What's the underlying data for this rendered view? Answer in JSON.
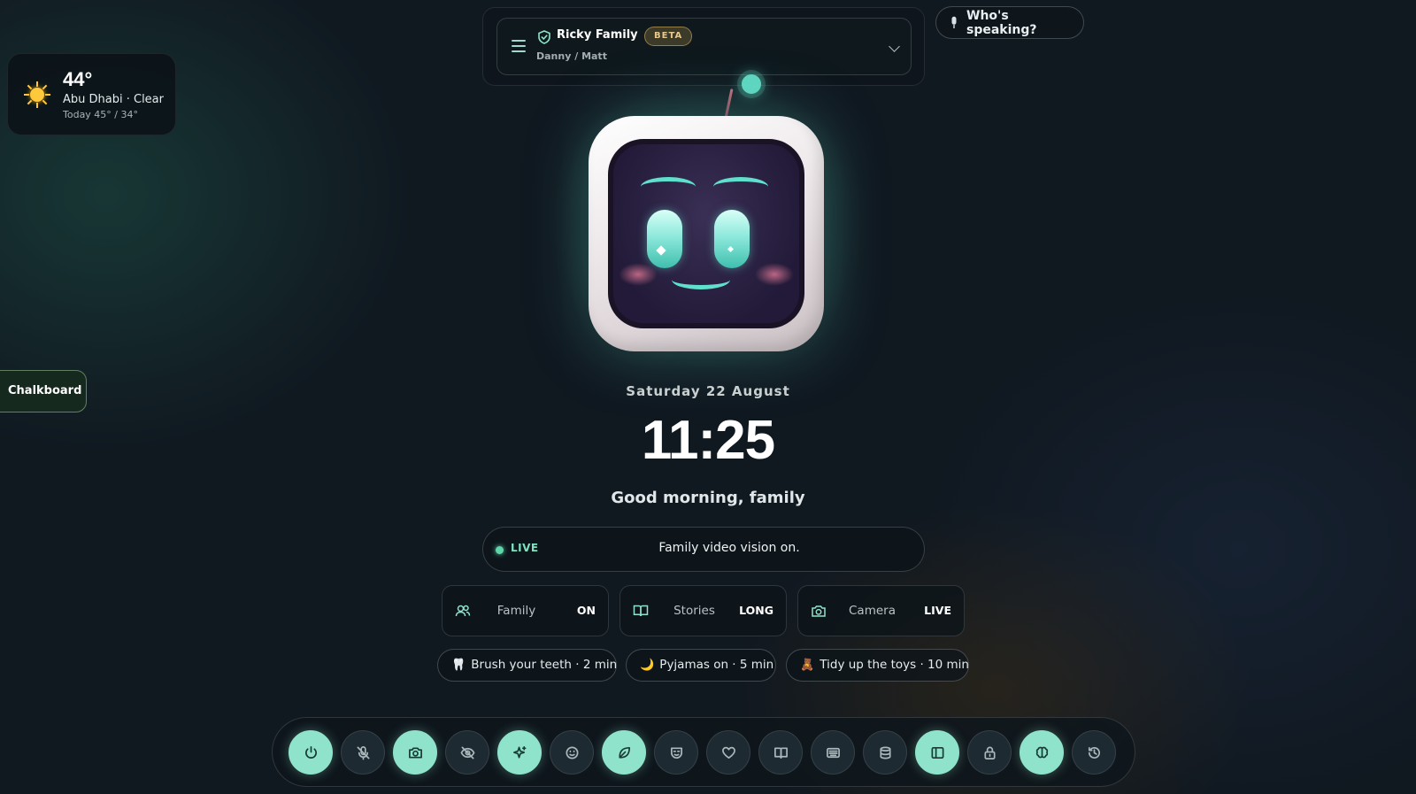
{
  "weather": {
    "temperature": "44°",
    "location": "Abu Dhabi · Clear",
    "forecast": "Today 45° / 34°",
    "icon": "sun-icon"
  },
  "header": {
    "title": "Ricky Family",
    "badge": "BETA",
    "subtitle": "Danny / Matt"
  },
  "speaking_button": {
    "label": "Who's speaking?",
    "icon": "microphone-icon"
  },
  "clock": {
    "date": "Saturday 22 August",
    "time": "11:25",
    "greeting": "Good morning, family"
  },
  "live_status": {
    "tag": "LIVE",
    "message": "Family video vision on."
  },
  "status_tiles": [
    {
      "name": "Family",
      "value": "ON",
      "icon": "family-icon"
    },
    {
      "name": "Stories",
      "value": "LONG",
      "icon": "book-icon"
    },
    {
      "name": "Camera",
      "value": "LIVE",
      "icon": "camera-icon"
    }
  ],
  "routines": [
    {
      "emoji": "🦷",
      "label": "Brush your teeth · 2 min"
    },
    {
      "emoji": "🌙",
      "label": "Pyjamas on · 5 min"
    },
    {
      "emoji": "🧸",
      "label": "Tidy up the toys · 10 min"
    }
  ],
  "chalkboard": {
    "label": "Chalkboard"
  },
  "dock": [
    {
      "name": "power-icon",
      "active": true
    },
    {
      "name": "mic-off-icon",
      "active": false
    },
    {
      "name": "camera-icon",
      "active": true
    },
    {
      "name": "eye-off-icon",
      "active": false
    },
    {
      "name": "sparkle-icon",
      "active": true
    },
    {
      "name": "face-icon",
      "active": false
    },
    {
      "name": "leaf-icon",
      "active": true
    },
    {
      "name": "mask-icon",
      "active": false
    },
    {
      "name": "heart-icon",
      "active": false
    },
    {
      "name": "book-icon",
      "active": false
    },
    {
      "name": "keyboard-icon",
      "active": false
    },
    {
      "name": "database-icon",
      "active": false
    },
    {
      "name": "panel-icon",
      "active": true
    },
    {
      "name": "lock-icon",
      "active": false
    },
    {
      "name": "brain-icon",
      "active": true
    },
    {
      "name": "history-icon",
      "active": false
    }
  ],
  "colors": {
    "accent": "#8fe3cb",
    "live": "#5fd6a8",
    "beta": "#e9c98a",
    "background": "#101820"
  }
}
